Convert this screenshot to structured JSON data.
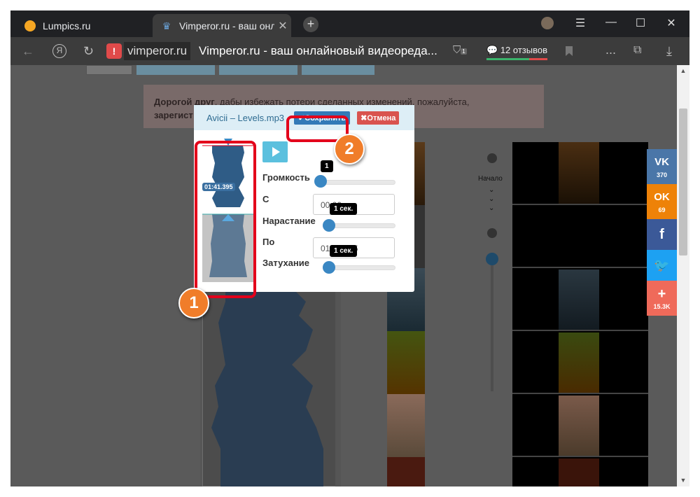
{
  "tabs": [
    {
      "title": "Lumpics.ru"
    },
    {
      "title": "Vimperor.ru - ваш онлай",
      "close": "✕"
    }
  ],
  "browser": {
    "domain": "vimperor.ru",
    "page_title": "Vimperor.ru - ваш онлайновый видеореда...",
    "reviews": "12 отзывов",
    "back_icon": "←",
    "ya_icon": "Я",
    "reload_icon": "↻",
    "warn_icon": "!",
    "new_tab": "+",
    "more": "...",
    "extensions_badge": "1"
  },
  "window": {
    "menu": "☰",
    "minimize": "—",
    "maximize": "☐",
    "close": "✕"
  },
  "page": {
    "notice_line1_bold": "Дорогой друг",
    "notice_line1": ", дабы избежать потери сделанных изменений, пожалуйста,",
    "notice_line2_bold": "зарегист",
    "start_label": "Начало"
  },
  "editor": {
    "file_name": "Avicii – Levels.mp3",
    "save_label": "Сохранить",
    "cancel_label": "Отмена",
    "time_badge": "01:41.395",
    "volume_label": "Громкость",
    "volume_value": "1",
    "from_label": "С",
    "from_value": "00:00",
    "fade_in_label": "Нарастание",
    "fade_in_value": "1 сек.",
    "to_label": "По",
    "to_value": "01:41.395",
    "fade_out_label": "Затухание",
    "fade_out_value": "1 сек."
  },
  "social": [
    {
      "name": "vk",
      "label": "VK",
      "count": "370",
      "color": "#4a76a8"
    },
    {
      "name": "ok",
      "label": "OK",
      "count": "69",
      "color": "#ee8208"
    },
    {
      "name": "facebook",
      "label": "f",
      "count": "",
      "color": "#3b5998"
    },
    {
      "name": "twitter",
      "label": "🐦",
      "count": "",
      "color": "#1da1f2"
    },
    {
      "name": "more",
      "label": "+",
      "count": "15.3K",
      "color": "#ef6a5a"
    }
  ],
  "annotations": {
    "one": "1",
    "two": "2"
  },
  "colors": {
    "accent": "#337ab7",
    "annotation_red": "#e3001b",
    "annotation_orange": "#f07d2a"
  }
}
